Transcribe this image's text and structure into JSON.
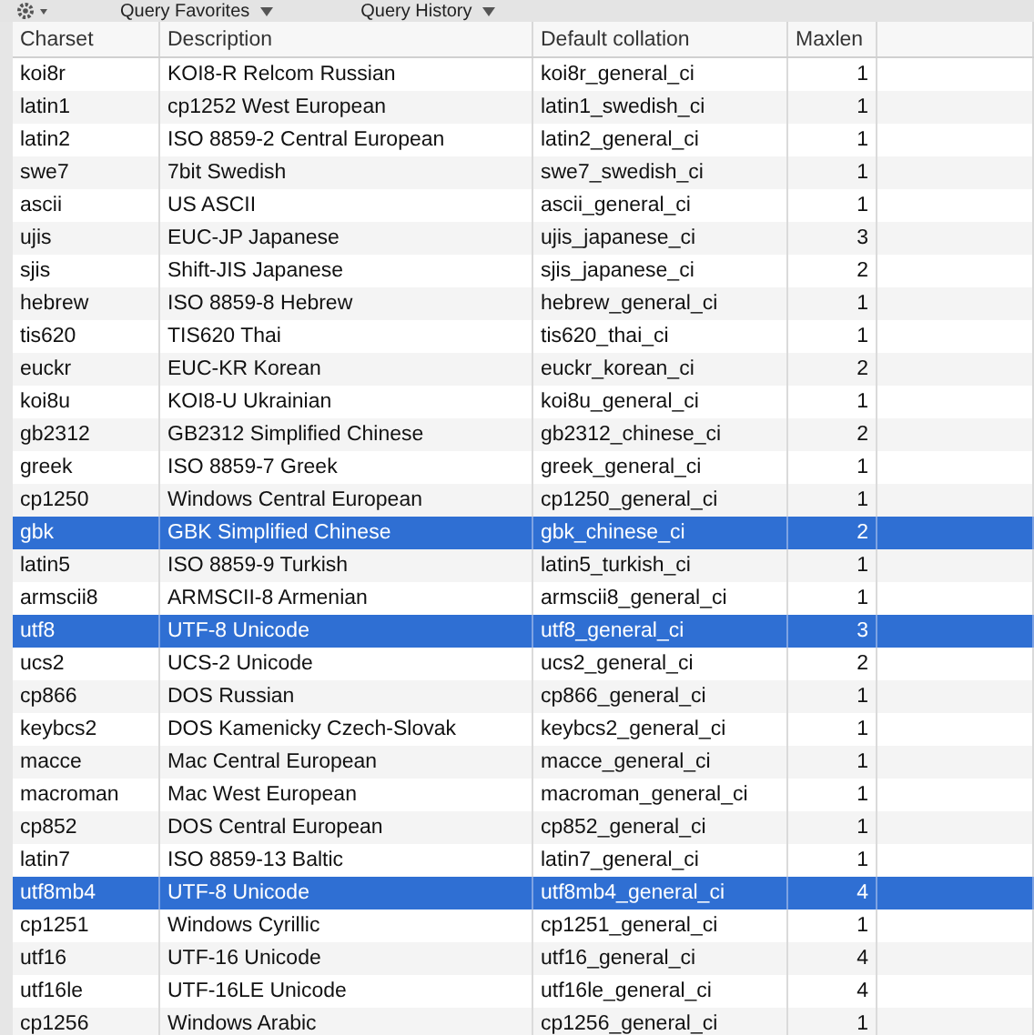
{
  "toolbar": {
    "items": [
      {
        "label": "Query Favorites"
      },
      {
        "label": "Query History"
      }
    ]
  },
  "table": {
    "columns": [
      "Charset",
      "Description",
      "Default collation",
      "Maxlen"
    ],
    "rows": [
      {
        "cells": [
          "koi8r",
          "KOI8-R Relcom Russian",
          "koi8r_general_ci",
          "1"
        ],
        "selected": false
      },
      {
        "cells": [
          "latin1",
          "cp1252 West European",
          "latin1_swedish_ci",
          "1"
        ],
        "selected": false
      },
      {
        "cells": [
          "latin2",
          "ISO 8859-2 Central European",
          "latin2_general_ci",
          "1"
        ],
        "selected": false
      },
      {
        "cells": [
          "swe7",
          "7bit Swedish",
          "swe7_swedish_ci",
          "1"
        ],
        "selected": false
      },
      {
        "cells": [
          "ascii",
          "US ASCII",
          "ascii_general_ci",
          "1"
        ],
        "selected": false
      },
      {
        "cells": [
          "ujis",
          "EUC-JP Japanese",
          "ujis_japanese_ci",
          "3"
        ],
        "selected": false
      },
      {
        "cells": [
          "sjis",
          "Shift-JIS Japanese",
          "sjis_japanese_ci",
          "2"
        ],
        "selected": false
      },
      {
        "cells": [
          "hebrew",
          "ISO 8859-8 Hebrew",
          "hebrew_general_ci",
          "1"
        ],
        "selected": false
      },
      {
        "cells": [
          "tis620",
          "TIS620 Thai",
          "tis620_thai_ci",
          "1"
        ],
        "selected": false
      },
      {
        "cells": [
          "euckr",
          "EUC-KR Korean",
          "euckr_korean_ci",
          "2"
        ],
        "selected": false
      },
      {
        "cells": [
          "koi8u",
          "KOI8-U Ukrainian",
          "koi8u_general_ci",
          "1"
        ],
        "selected": false
      },
      {
        "cells": [
          "gb2312",
          "GB2312 Simplified Chinese",
          "gb2312_chinese_ci",
          "2"
        ],
        "selected": false
      },
      {
        "cells": [
          "greek",
          "ISO 8859-7 Greek",
          "greek_general_ci",
          "1"
        ],
        "selected": false
      },
      {
        "cells": [
          "cp1250",
          "Windows Central European",
          "cp1250_general_ci",
          "1"
        ],
        "selected": false
      },
      {
        "cells": [
          "gbk",
          "GBK Simplified Chinese",
          "gbk_chinese_ci",
          "2"
        ],
        "selected": true
      },
      {
        "cells": [
          "latin5",
          "ISO 8859-9 Turkish",
          "latin5_turkish_ci",
          "1"
        ],
        "selected": false
      },
      {
        "cells": [
          "armscii8",
          "ARMSCII-8 Armenian",
          "armscii8_general_ci",
          "1"
        ],
        "selected": false
      },
      {
        "cells": [
          "utf8",
          "UTF-8 Unicode",
          "utf8_general_ci",
          "3"
        ],
        "selected": true
      },
      {
        "cells": [
          "ucs2",
          "UCS-2 Unicode",
          "ucs2_general_ci",
          "2"
        ],
        "selected": false
      },
      {
        "cells": [
          "cp866",
          "DOS Russian",
          "cp866_general_ci",
          "1"
        ],
        "selected": false
      },
      {
        "cells": [
          "keybcs2",
          "DOS Kamenicky Czech-Slovak",
          "keybcs2_general_ci",
          "1"
        ],
        "selected": false
      },
      {
        "cells": [
          "macce",
          "Mac Central European",
          "macce_general_ci",
          "1"
        ],
        "selected": false
      },
      {
        "cells": [
          "macroman",
          "Mac West European",
          "macroman_general_ci",
          "1"
        ],
        "selected": false
      },
      {
        "cells": [
          "cp852",
          "DOS Central European",
          "cp852_general_ci",
          "1"
        ],
        "selected": false
      },
      {
        "cells": [
          "latin7",
          "ISO 8859-13 Baltic",
          "latin7_general_ci",
          "1"
        ],
        "selected": false
      },
      {
        "cells": [
          "utf8mb4",
          "UTF-8 Unicode",
          "utf8mb4_general_ci",
          "4"
        ],
        "selected": true
      },
      {
        "cells": [
          "cp1251",
          "Windows Cyrillic",
          "cp1251_general_ci",
          "1"
        ],
        "selected": false
      },
      {
        "cells": [
          "utf16",
          "UTF-16 Unicode",
          "utf16_general_ci",
          "4"
        ],
        "selected": false
      },
      {
        "cells": [
          "utf16le",
          "UTF-16LE Unicode",
          "utf16le_general_ci",
          "4"
        ],
        "selected": false
      },
      {
        "cells": [
          "cp1256",
          "Windows Arabic",
          "cp1256_general_ci",
          "1"
        ],
        "selected": false
      }
    ]
  }
}
